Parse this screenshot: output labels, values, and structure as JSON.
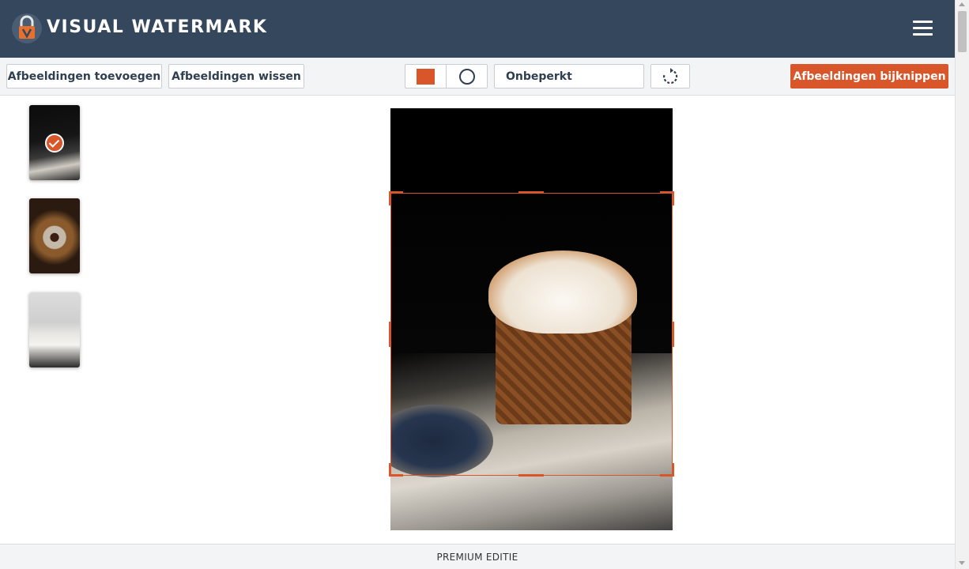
{
  "app": {
    "title": "VISUAL WATERMARK"
  },
  "icons": {
    "logo": "lock-logo-icon",
    "menu": "hamburger-menu-icon",
    "rotate": "rotate-icon",
    "check": "check-icon",
    "square": "square-shape-icon",
    "circle": "circle-shape-icon"
  },
  "colors": {
    "header": "#35475c",
    "accent": "#d9562b",
    "toolbar": "#f3f4f5"
  },
  "toolbar": {
    "add_images": "Afbeeldingen toevoegen",
    "clear_images": "Afbeeldingen wissen",
    "aspect_ratio": "Onbeperkt",
    "crop_images": "Afbeeldingen bijknippen"
  },
  "thumbnails": [
    {
      "selected": true
    },
    {
      "selected": false
    },
    {
      "selected": false
    }
  ],
  "footer": {
    "edition": "PREMIUM EDITIE"
  }
}
